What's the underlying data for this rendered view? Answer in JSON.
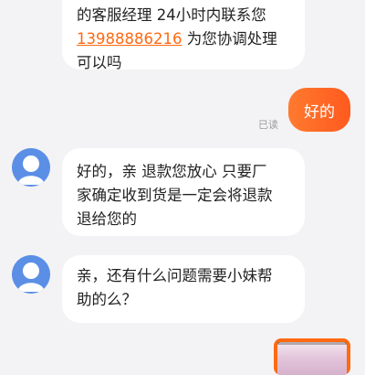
{
  "messages": {
    "top_bubble": {
      "line1": "的客服经理 24小时内联系您",
      "phone": "13988886216",
      "line2_suffix": " 为您协调处理",
      "line3": "可以吗"
    },
    "sent_bubble": {
      "text": "好的"
    },
    "read_status": "已读",
    "reply_1": {
      "line1": "好的，亲 退款您放心 只要厂",
      "line2": "家确定收到货是一定会将退款",
      "line3": "退给您的"
    },
    "reply_2": {
      "line1": "亲，还有什么问题需要小妹帮",
      "line2": "助的么？"
    }
  },
  "colors": {
    "accent": "#ff6a13",
    "avatar": "#5b8fe6",
    "background": "#f3f3f5"
  },
  "icons": {
    "agent_avatar": "user-avatar-icon",
    "thumbnail": "image-thumbnail"
  }
}
